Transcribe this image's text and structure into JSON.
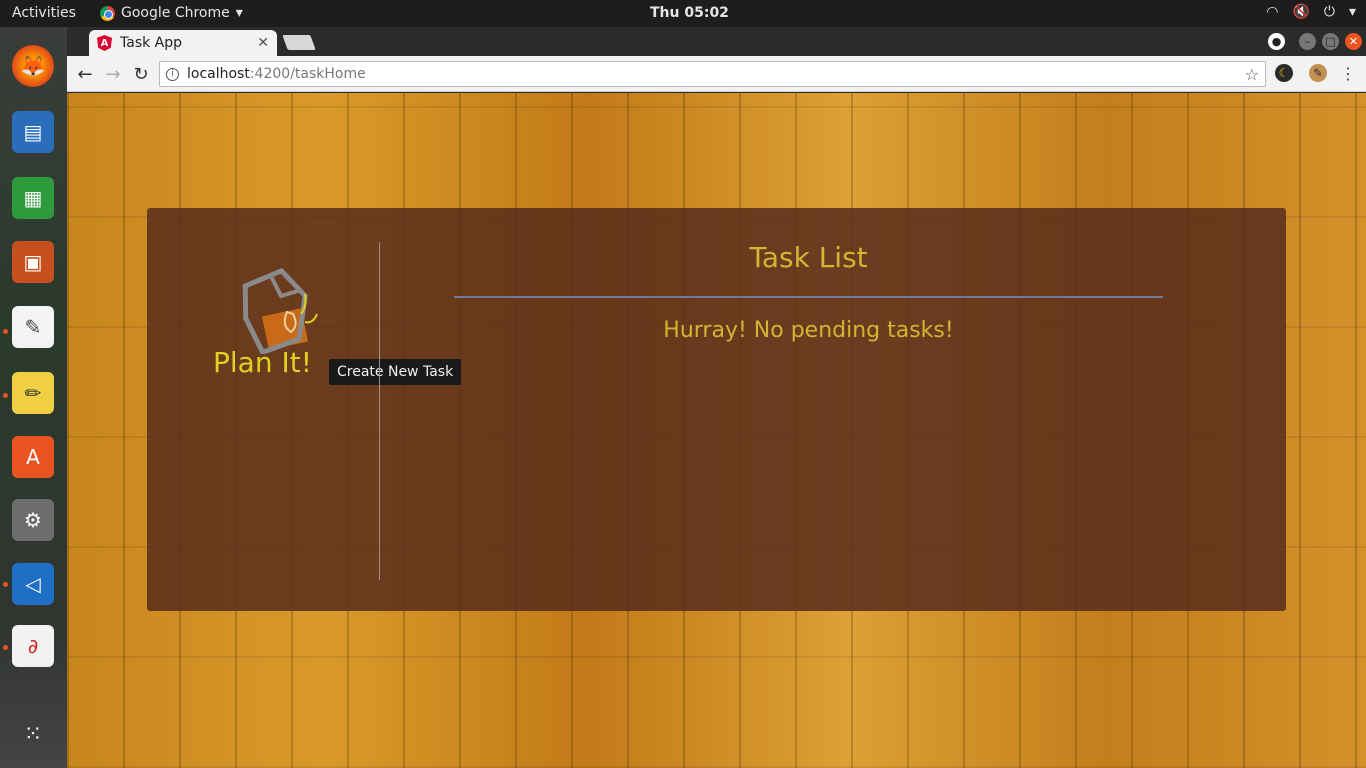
{
  "system": {
    "activities": "Activities",
    "app_name": "Google Chrome",
    "clock": "Thu 05:02"
  },
  "browser": {
    "tab_title": "Task App",
    "url_host": "localhost",
    "url_rest": ":4200/taskHome"
  },
  "page": {
    "logo_text": "Plan It!",
    "tooltip": "Create New Task",
    "title": "Task List",
    "message": "Hurray! No pending tasks!"
  },
  "colors": {
    "accent_text": "#d6b431",
    "panel": "#582c1c",
    "logo_text": "#e0d020"
  }
}
